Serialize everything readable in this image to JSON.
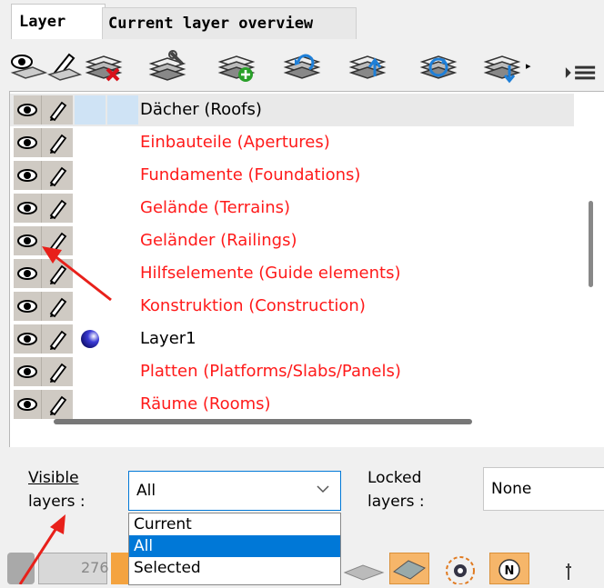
{
  "tabs": [
    {
      "label": "Layer"
    },
    {
      "label": "Current layer overview"
    }
  ],
  "toolbar": {
    "icons": [
      "eye-layer-icon",
      "pencil-layer-icon",
      "delete-layer-icon",
      "layer-settings-icon",
      "add-layer-icon",
      "rotate-layer-icon",
      "move-layer-up-icon",
      "refresh-layer-icon",
      "layer-more-icon",
      "menu-icon"
    ]
  },
  "layers": [
    {
      "name": "Dächer (Roofs)",
      "color": "#000000",
      "selected": true,
      "ball": false
    },
    {
      "name": "Einbauteile (Apertures)",
      "color": "#ff1a1a",
      "selected": false,
      "ball": false
    },
    {
      "name": "Fundamente (Foundations)",
      "color": "#ff1a1a",
      "selected": false,
      "ball": false
    },
    {
      "name": "Gelände (Terrains)",
      "color": "#ff1a1a",
      "selected": false,
      "ball": false
    },
    {
      "name": "Geländer (Railings)",
      "color": "#ff1a1a",
      "selected": false,
      "ball": false
    },
    {
      "name": "Hilfselemente (Guide elements)",
      "color": "#ff1a1a",
      "selected": false,
      "ball": false
    },
    {
      "name": "Konstruktion (Construction)",
      "color": "#ff1a1a",
      "selected": false,
      "ball": false
    },
    {
      "name": "Layer1",
      "color": "#000000",
      "selected": false,
      "ball": true
    },
    {
      "name": "Platten (Platforms/Slabs/Panels)",
      "color": "#ff1a1a",
      "selected": false,
      "ball": false
    },
    {
      "name": "Räume (Rooms)",
      "color": "#ff1a1a",
      "selected": false,
      "ball": false
    }
  ],
  "visible": {
    "label_line1": "Visible",
    "label_line2": "layers :",
    "value": "All",
    "options": [
      "Current",
      "All",
      "Selected"
    ],
    "highlighted": "All"
  },
  "locked": {
    "label_line1": "Locked",
    "label_line2": "layers :",
    "value": "None"
  },
  "strip": {
    "number": "276"
  },
  "colors": {
    "accent": "#0078d7",
    "inactive_layer_text": "#ff1a1a",
    "annotation_arrow": "#e8201a"
  }
}
